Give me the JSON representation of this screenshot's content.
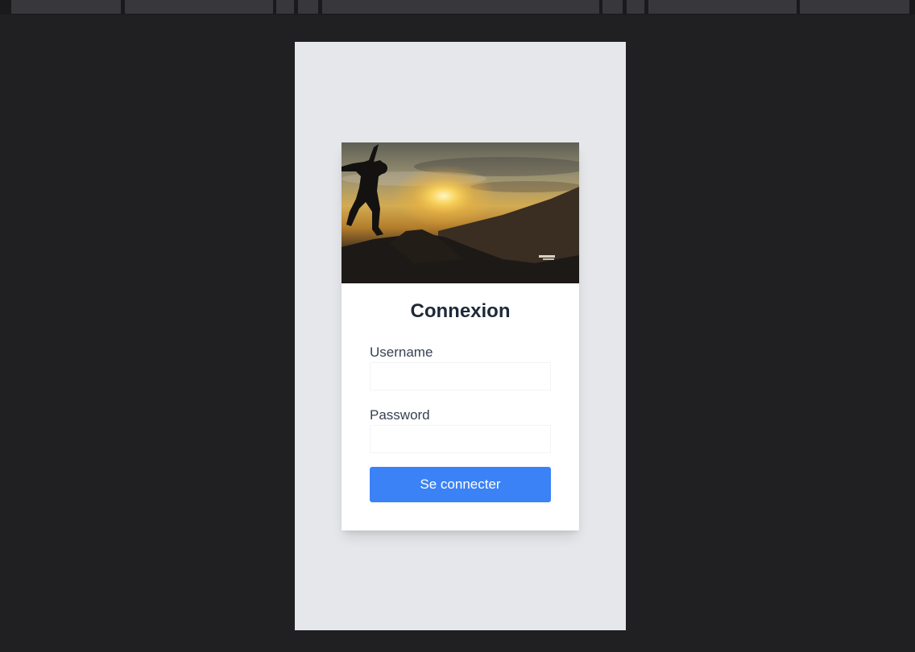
{
  "colors": {
    "page_background": "#202022",
    "device_background": "#e5e7eb",
    "card_background": "#ffffff",
    "title_color": "#1f2937",
    "button_background": "#3b82f6",
    "button_text": "#ffffff"
  },
  "login": {
    "title": "Connexion",
    "username_label": "Username",
    "username_value": "",
    "password_label": "Password",
    "password_value": "",
    "submit_label": "Se connecter"
  },
  "hero_image": {
    "icon": "sunset-jumper-photo"
  }
}
